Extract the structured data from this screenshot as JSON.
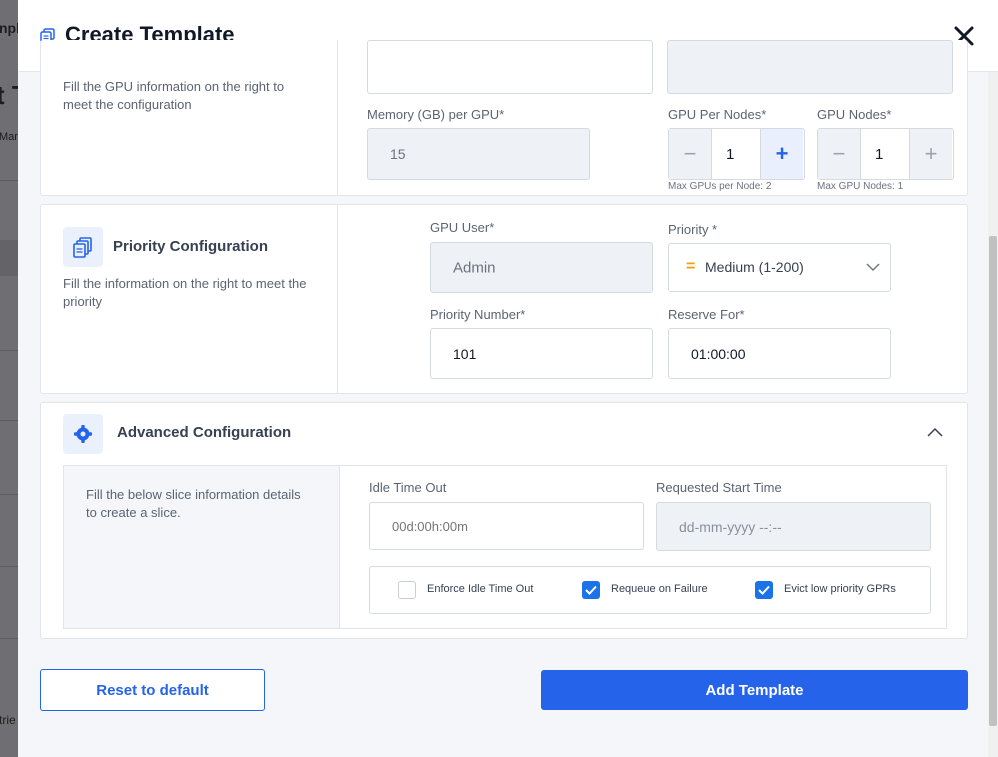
{
  "background": {
    "fragments": [
      "npl",
      "t T",
      "Mar",
      "trie"
    ]
  },
  "modal": {
    "title": "Create Template",
    "gpu_section": {
      "description": "Fill the GPU information on the right to meet the configuration",
      "gpu_model_value": "...",
      "gpu_type_value": "...",
      "memory_label": "Memory (GB) per GPU*",
      "memory_value": "15",
      "gpu_per_nodes_label": "GPU Per Nodes*",
      "gpu_per_nodes_value": "1",
      "gpu_per_nodes_hint": "Max GPUs per Node: 2",
      "gpu_nodes_label": "GPU Nodes*",
      "gpu_nodes_value": "1",
      "gpu_nodes_hint": "Max GPU Nodes: 1"
    },
    "priority_section": {
      "title": "Priority Configuration",
      "description": "Fill the information on the right to meet the priority",
      "gpu_user_label": "GPU User*",
      "gpu_user_value": "Admin",
      "priority_label": "Priority *",
      "priority_value": "Medium (1-200)",
      "priority_symbol": "=",
      "priority_color": "#f59e0b",
      "priority_number_label": "Priority Number*",
      "priority_number_value": "101",
      "reserve_for_label": "Reserve For*",
      "reserve_for_value": "01:00:00"
    },
    "advanced_section": {
      "title": "Advanced Configuration",
      "description": "Fill the below slice information details to create a slice.",
      "idle_timeout_label": "Idle Time Out",
      "idle_timeout_placeholder": "00d:00h:00m",
      "requested_start_label": "Requested Start Time",
      "requested_start_placeholder": "dd-mm-yyyy --:--",
      "checkboxes": [
        {
          "label": "Enforce Idle Time Out",
          "checked": false
        },
        {
          "label": "Requeue on Failure",
          "checked": true
        },
        {
          "label": "Evict low priority GPRs",
          "checked": true
        }
      ]
    },
    "actions": {
      "reset_label": "Reset to default",
      "add_label": "Add Template"
    }
  },
  "colors": {
    "accent": "#2563eb",
    "checkbox_checked": "#1a73e8"
  }
}
